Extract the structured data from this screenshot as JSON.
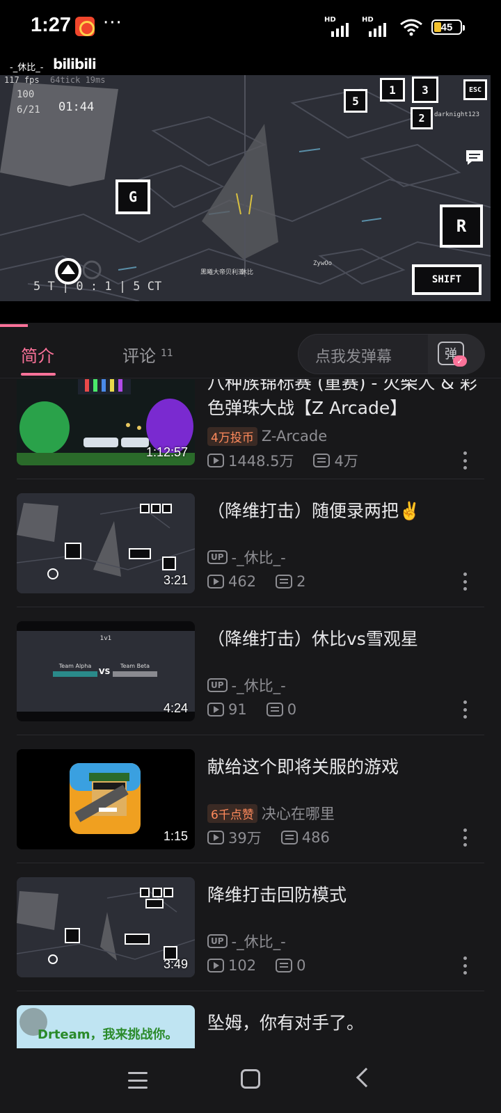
{
  "status_bar": {
    "time": "1:27",
    "more": "···",
    "signal1_label": "HD",
    "signal2_label": "HD",
    "battery": "45"
  },
  "player": {
    "uploader_overlay": "-_休比_-",
    "logo": "bilibili",
    "hud": {
      "fps": "117 fps",
      "ping": "64tick 19ms",
      "health": "100",
      "ammo": "6/21",
      "timer": "01:44",
      "score": "5 T | 0 : 1 | 5 CT",
      "key_g": "G",
      "key_r": "R",
      "key_shift": "SHIFT",
      "key_esc": "ESC",
      "key_1": "1",
      "key_2": "2",
      "key_3": "3",
      "key_5": "5",
      "player_name_1": "ZywOo",
      "player_name_2": "休比",
      "player_name_3": "黑曦大帝贝利亚",
      "player_name_4": "darknight123"
    },
    "progress": 0.055
  },
  "tabs": {
    "intro": "简介",
    "comments": "评论",
    "comments_count": "11",
    "danmaku_placeholder": "点我发弹幕",
    "danmaku_icon_text": "弹"
  },
  "videos": [
    {
      "title": "八种族锦标赛 (重赛) - 火柴人 & 彩色弹珠大战【Z Arcade】",
      "badge": "4万投币",
      "uploader": "Z-Arcade",
      "views": "1448.5万",
      "danmaku": "4万",
      "duration": "1:12:57"
    },
    {
      "title": "（降维打击）随便录两把✌️",
      "badge": "",
      "uploader": "-_休比_-",
      "up_tag": "UP",
      "views": "462",
      "danmaku": "2",
      "duration": "3:21"
    },
    {
      "title": "（降维打击）休比vs雪观星",
      "badge": "",
      "uploader": "-_休比_-",
      "up_tag": "UP",
      "views": "91",
      "danmaku": "0",
      "duration": "4:24",
      "thumb_text": {
        "mode": "1v1",
        "team_a": "Team Alpha",
        "vs": "VS",
        "team_b": "Team Beta"
      }
    },
    {
      "title": "献给这个即将关服的游戏",
      "badge": "6千点赞",
      "uploader": "决心在哪里",
      "views": "39万",
      "danmaku": "486",
      "duration": "1:15"
    },
    {
      "title": "降维打击回防模式",
      "badge": "",
      "uploader": "-_休比_-",
      "up_tag": "UP",
      "views": "102",
      "danmaku": "0",
      "duration": "3:49"
    },
    {
      "title": "坠姆，你有对手了。",
      "thumb_caption": "Drteam，我来挑战你。"
    }
  ],
  "colors": {
    "accent": "#fb7299",
    "background": "#18181a",
    "badge_text": "#ff8a5c"
  }
}
